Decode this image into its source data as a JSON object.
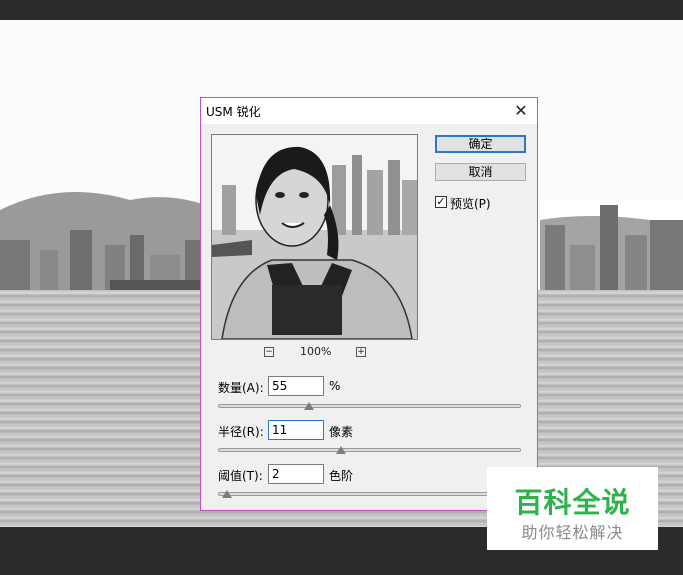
{
  "dialog": {
    "title": "USM 锐化",
    "close_glyph": "✕",
    "ok_label": "确定",
    "cancel_label": "取消",
    "preview": {
      "checked": true,
      "check_glyph": "✓",
      "label": "预览(P)"
    },
    "zoom": {
      "minus_glyph": "−",
      "plus_glyph": "+",
      "level": "100%"
    },
    "params": [
      {
        "label": "数量(A):",
        "value": "55",
        "unit": "%",
        "slider_percent": 29
      },
      {
        "label": "半径(R):",
        "value": "11",
        "unit": "像素",
        "slider_percent": 40
      },
      {
        "label": "阈值(T):",
        "value": "2",
        "unit": "色阶",
        "slider_percent": 1
      }
    ]
  },
  "watermark": {
    "title": "百科全说",
    "subtitle": "助你轻松解决"
  },
  "colors": {
    "dialog_border": "#c64fc2",
    "ok_border": "#2b78c8",
    "watermark_green": "#2db34a"
  },
  "icons": {
    "close": "close-icon",
    "zoom_out": "zoom-out-icon",
    "zoom_in": "zoom-in-icon",
    "check": "checkmark-icon"
  }
}
